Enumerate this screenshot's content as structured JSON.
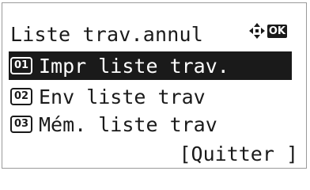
{
  "screen": {
    "title": "Liste trav.annul",
    "nav": {
      "arrows_icon": "four-way-arrows-icon",
      "ok_label": "OK"
    },
    "menu": {
      "items": [
        {
          "number": "01",
          "label": "Impr liste trav.",
          "selected": true
        },
        {
          "number": "02",
          "label": "Env liste trav",
          "selected": false
        },
        {
          "number": "03",
          "label": "Mém. liste trav",
          "selected": false
        }
      ]
    },
    "quit_label": "[Quitter ]"
  },
  "colors": {
    "text": "#1a1a1a",
    "selected_background": "#1a1a1a",
    "selected_text": "#ffffff",
    "panel_border": "#9a9a9a"
  }
}
